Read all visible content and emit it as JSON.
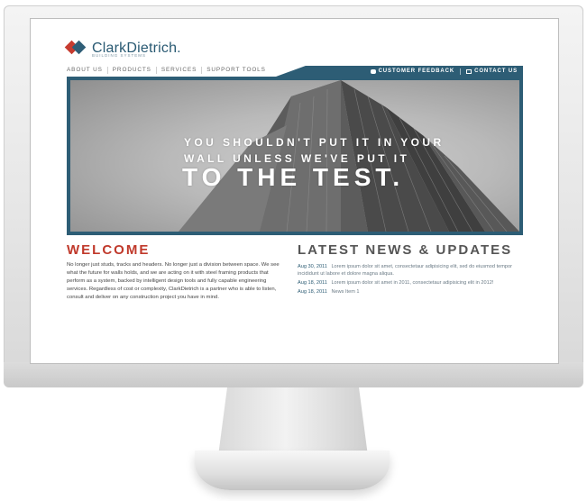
{
  "brand": {
    "name": "ClarkDietrich.",
    "tagline": "BUILDING SYSTEMS",
    "colors": {
      "red": "#c0392b",
      "blue": "#2d5d75"
    }
  },
  "nav": {
    "items": [
      {
        "label": "ABOUT US"
      },
      {
        "label": "PRODUCTS"
      },
      {
        "label": "SERVICES"
      },
      {
        "label": "SUPPORT TOOLS"
      }
    ]
  },
  "utility": {
    "feedback": {
      "label": "CUSTOMER FEEDBACK",
      "icon": "speech-bubble-icon"
    },
    "contact": {
      "label": "CONTACT US",
      "icon": "envelope-icon"
    }
  },
  "hero": {
    "line1": "YOU SHOULDN'T PUT IT IN YOUR",
    "line2": "WALL UNLESS WE'VE PUT IT",
    "line3": "TO THE TEST."
  },
  "welcome": {
    "title": "WELCOME",
    "body": "No longer just studs, tracks and headers. No longer just a division between space. We see what the future for walls holds, and we are acting on it with steel framing products that perform as a system, backed by intelligent design tools and fully capable engineering services. Regardless of cost or complexity, ClarkDietrich is a partner who is able to listen, consult and deliver on any construction project you have in mind."
  },
  "news": {
    "title": "LATEST NEWS & UPDATES",
    "items": [
      {
        "date": "Aug 30, 2011",
        "text": "Lorem ipsum dolor sit amet, consectetaur adipisicing elit, sed do eiusmod tempor incididunt ut labore et dolore magna aliqua."
      },
      {
        "date": "Aug 18, 2011",
        "text": "Lorem ipsum dolor sit amet in 2011, consectetaur adipisicing elit in 2012!"
      },
      {
        "date": "Aug 18, 2011",
        "text": "News Item 1"
      }
    ]
  }
}
